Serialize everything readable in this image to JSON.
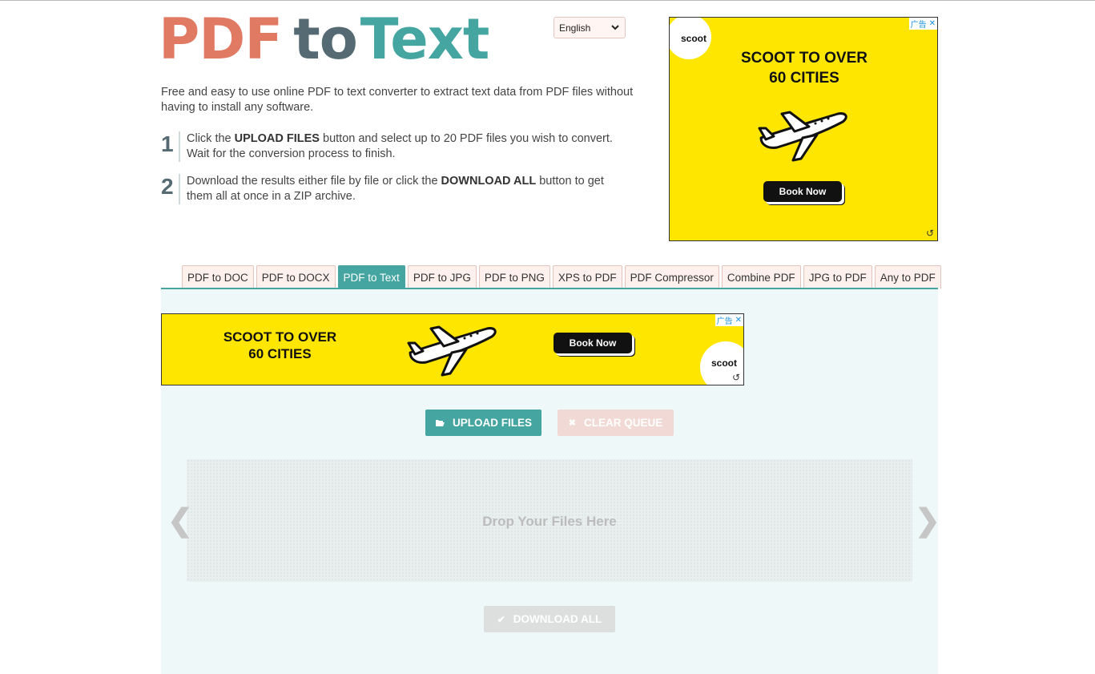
{
  "logo": {
    "part1": "PDF",
    "part2": "to",
    "part3": "Text"
  },
  "language": {
    "selected": "English"
  },
  "intro": "Free and easy to use online PDF to text converter to extract text data from PDF files without having to install any software.",
  "steps": [
    {
      "num": "1",
      "pre": "Click the ",
      "bold": "UPLOAD FILES",
      "post": " button and select up to 20 PDF files you wish to convert. Wait for the conversion process to finish."
    },
    {
      "num": "2",
      "pre": "Download the results either file by file or click the ",
      "bold": "DOWNLOAD ALL",
      "post": " button to get them all at once in a ZIP archive."
    }
  ],
  "ads": {
    "brand": "scoot",
    "headline_line1": "SCOOT TO OVER",
    "headline_line2": "60 CITIES",
    "cta": "Book Now",
    "adchoice": "广告",
    "close": "✕",
    "refresh": "↺"
  },
  "tabs": [
    {
      "label": "PDF to DOC",
      "active": false
    },
    {
      "label": "PDF to DOCX",
      "active": false
    },
    {
      "label": "PDF to Text",
      "active": true
    },
    {
      "label": "PDF to JPG",
      "active": false
    },
    {
      "label": "PDF to PNG",
      "active": false
    },
    {
      "label": "XPS to PDF",
      "active": false
    },
    {
      "label": "PDF Compressor",
      "active": false
    },
    {
      "label": "Combine PDF",
      "active": false
    },
    {
      "label": "JPG to PDF",
      "active": false
    },
    {
      "label": "Any to PDF",
      "active": false
    }
  ],
  "buttons": {
    "upload": "UPLOAD FILES",
    "clear": "CLEAR QUEUE",
    "download_all": "DOWNLOAD ALL"
  },
  "dropzone": {
    "text": "Drop Your Files Here"
  },
  "nav": {
    "prev": "❮",
    "next": "❯"
  },
  "colors": {
    "accent": "#45a5a1",
    "logo_red": "#e07a63",
    "logo_gray": "#556a73",
    "ad_yellow": "#ffe600"
  }
}
